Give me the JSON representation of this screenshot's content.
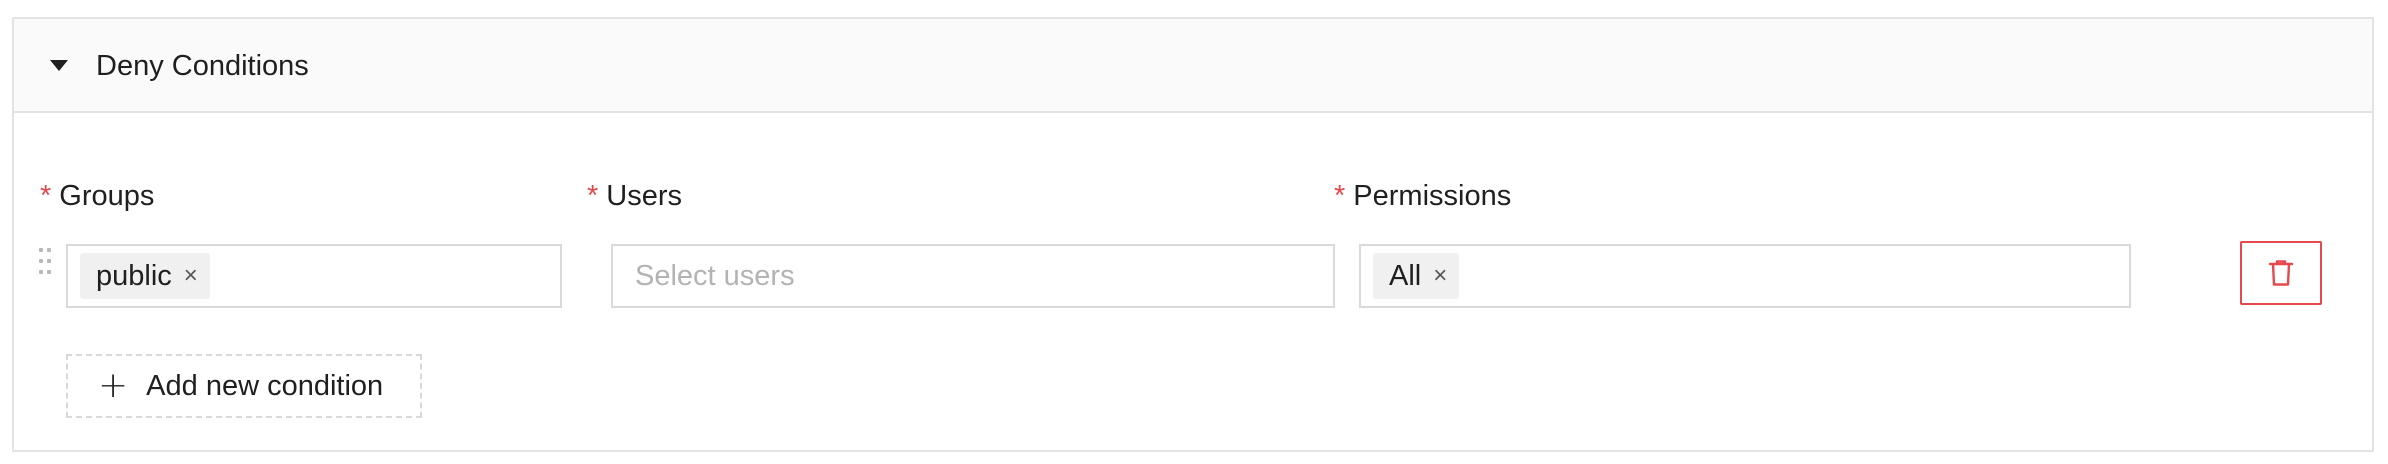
{
  "panel": {
    "title": "Deny Conditions",
    "collapse_icon": "caret-down-icon"
  },
  "required_marker": "*",
  "fields": {
    "groups": {
      "label": "Groups",
      "tags": [
        "public"
      ]
    },
    "users": {
      "label": "Users",
      "placeholder": "Select users"
    },
    "permissions": {
      "label": "Permissions",
      "tags": [
        "All"
      ]
    }
  },
  "tag_remove_glyph": "×",
  "delete_icon": "trash-icon",
  "drag_icon": "drag-handle-icon",
  "add_button": {
    "icon": "+",
    "label": "Add new condition"
  },
  "colors": {
    "required": "#e5484d",
    "danger": "#e5484d",
    "border": "#d9d9d9",
    "header_bg": "#fafafa"
  }
}
